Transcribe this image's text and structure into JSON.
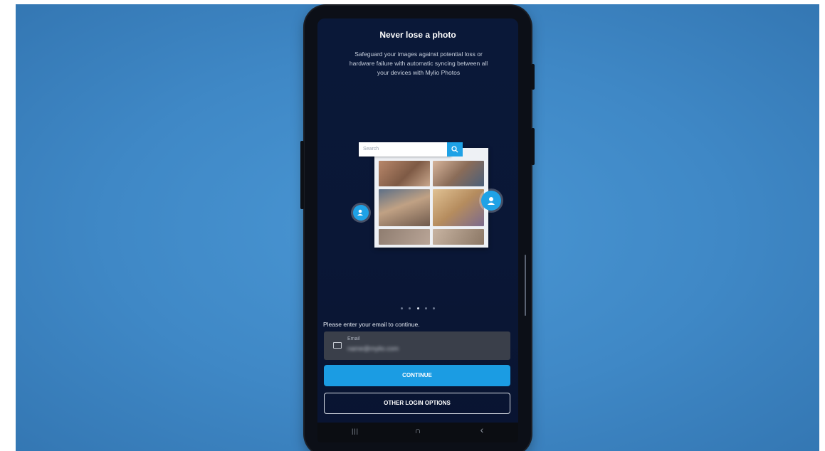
{
  "onboarding": {
    "title": "Never lose a photo",
    "description": "Safeguard your images against potential loss or hardware failure with automatic syncing between all your devices with Mylio Photos",
    "illustration": {
      "search_placeholder": "Search",
      "search_icon": "search-icon",
      "left_badge_icon": "person-search-icon",
      "right_badge_icon": "face-tag-icon"
    },
    "pager": {
      "count": 5,
      "active_index": 2
    }
  },
  "login": {
    "prompt": "Please enter your email to continue.",
    "email": {
      "icon": "envelope-icon",
      "label": "Email",
      "value": "name@mylio.com"
    },
    "continue_label": "CONTINUE",
    "other_options_label": "OTHER LOGIN OPTIONS"
  },
  "system_nav": {
    "recents_glyph": "|||",
    "home_glyph": "∩",
    "back_glyph": "‹"
  },
  "colors": {
    "background": "#3f88c6",
    "screen": "#0a1736",
    "accent": "#1b9ce3",
    "field": "#3a3f4a"
  }
}
